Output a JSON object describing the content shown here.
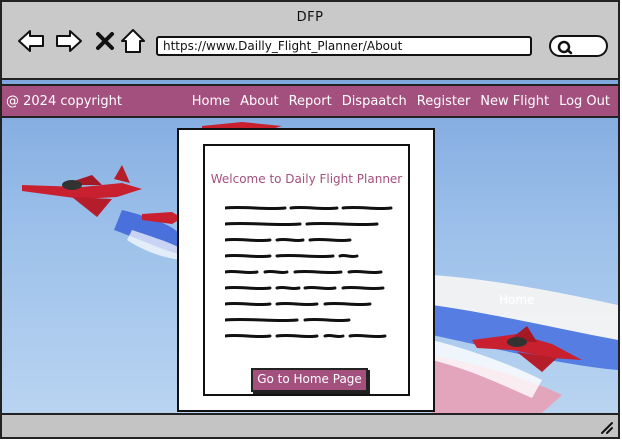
{
  "window": {
    "title": "DFP"
  },
  "browser": {
    "url": "https://www.Dailly_Flight_Planner/About"
  },
  "site": {
    "copyright": "@ 2024 copyright",
    "nav": [
      "Home",
      "About",
      "Report",
      "Dispaatch",
      "Register",
      "New Flight",
      "Log Out"
    ],
    "modal": {
      "heading": "Welcome to Daily Flight Planner",
      "button": "Go to Home Page"
    },
    "background_label": "Home"
  },
  "colors": {
    "accent": "#a3507f",
    "sky": "#9cc0ea",
    "chrome": "#c9c9c9"
  }
}
